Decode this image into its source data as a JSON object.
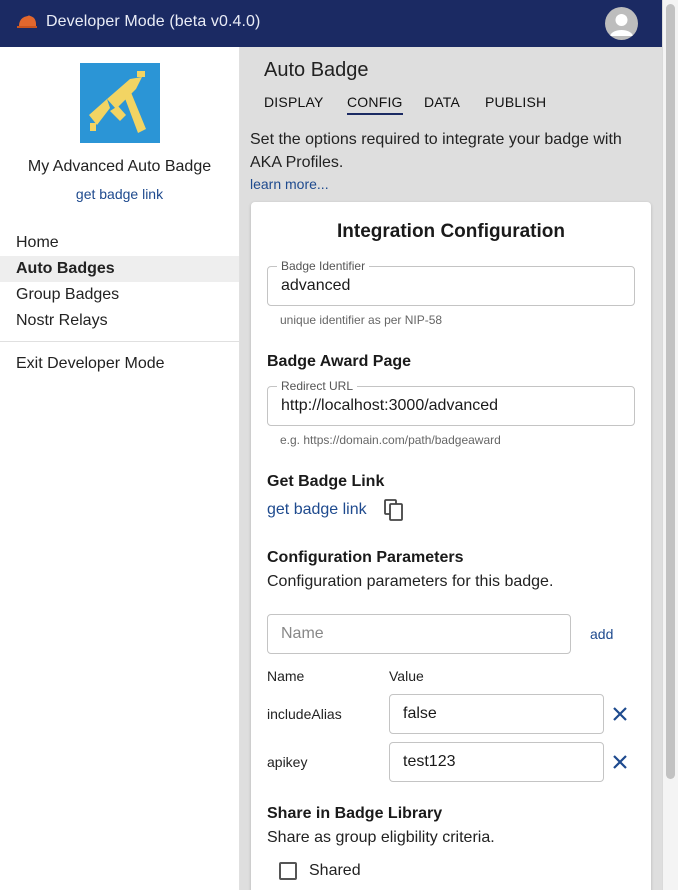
{
  "appbar": {
    "title": "Developer Mode (beta v0.4.0)",
    "logo_icon": "cap-icon",
    "avatar_icon": "account-circle-icon"
  },
  "sidebar": {
    "badge_name": "My Advanced Auto Badge",
    "badge_link": "get badge link",
    "nav": [
      {
        "label": "Home"
      },
      {
        "label": "Auto Badges"
      },
      {
        "label": "Group Badges"
      },
      {
        "label": "Nostr Relays"
      }
    ],
    "exit": "Exit Developer Mode"
  },
  "main": {
    "page_title": "Auto Badge",
    "tabs": [
      {
        "label": "DISPLAY"
      },
      {
        "label": "CONFIG"
      },
      {
        "label": "DATA"
      },
      {
        "label": "PUBLISH"
      }
    ],
    "intro": "Set the options required to integrate your badge with AKA Profiles.",
    "learn_more": "learn more..."
  },
  "card": {
    "title": "Integration Configuration",
    "identifier": {
      "legend": "Badge Identifier",
      "value": "advanced",
      "helper": "unique identifier as per NIP-58"
    },
    "award": {
      "heading": "Badge Award Page",
      "legend": "Redirect URL",
      "value": "http://localhost:3000/advanced",
      "helper": "e.g. https://domain.com/path/badgeaward"
    },
    "getlink": {
      "heading": "Get Badge Link",
      "link": "get badge link",
      "icon": "copy-icon"
    },
    "params": {
      "heading": "Configuration Parameters",
      "description": "Configuration parameters for this badge.",
      "name_placeholder": "Name",
      "add_label": "add",
      "col_name": "Name",
      "col_value": "Value",
      "rows": [
        {
          "name": "includeAlias",
          "value": "false"
        },
        {
          "name": "apikey",
          "value": "test123"
        }
      ]
    },
    "share": {
      "heading": "Share in Badge Library",
      "description": "Share as group eligbility criteria.",
      "checkbox_label": "Shared",
      "checked": false
    }
  },
  "colors": {
    "appbar": "#1b2a63",
    "link": "#1e4a8e",
    "main_bg": "#dedede"
  }
}
